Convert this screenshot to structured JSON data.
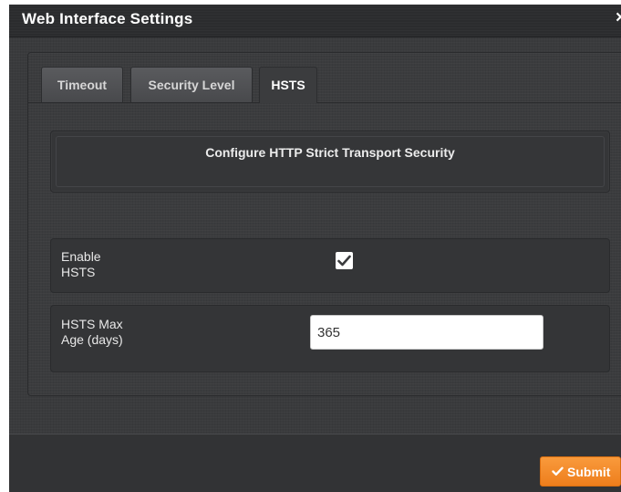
{
  "dialog": {
    "title": "Web Interface Settings",
    "close_symbol": "×"
  },
  "tabs": [
    {
      "label": "Timeout",
      "active": false
    },
    {
      "label": "Security Level",
      "active": false
    },
    {
      "label": "HSTS",
      "active": true
    }
  ],
  "section": {
    "title": "Configure HTTP Strict Transport Security"
  },
  "fields": {
    "enable_hsts": {
      "label_line1": "Enable",
      "label_line2": "HSTS",
      "checked": true,
      "icon": "checkmark-icon"
    },
    "max_age": {
      "label_line1": "HSTS Max",
      "label_line2": "Age (days)",
      "value": "365"
    }
  },
  "footer": {
    "submit_label": "Submit",
    "submit_icon": "checkmark-icon"
  },
  "colors": {
    "dialog_background": "#3a3b3d",
    "title_text": "#ffffff",
    "submit_accent": "#f28a2a"
  }
}
